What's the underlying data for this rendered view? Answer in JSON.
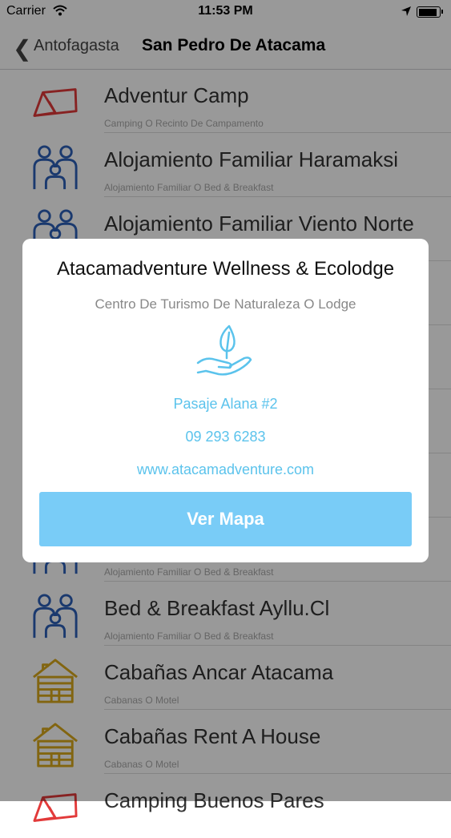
{
  "status_bar": {
    "carrier": "Carrier",
    "time": "11:53 PM",
    "battery_level": 0.9
  },
  "nav": {
    "back_label": "Antofagasta",
    "title": "San Pedro De Atacama"
  },
  "list": [
    {
      "title": "Adventur Camp",
      "subtitle": "Camping O Recinto De Campamento",
      "icon": "tent-icon"
    },
    {
      "title": "Alojamiento Familiar Haramaksi",
      "subtitle": "Alojamiento Familiar O Bed & Breakfast",
      "icon": "family-icon"
    },
    {
      "title": "Alojamiento Familiar Viento Norte",
      "subtitle": "",
      "icon": "family-icon"
    },
    {
      "title": "",
      "subtitle": "",
      "icon": ""
    },
    {
      "title": "",
      "subtitle": "",
      "icon": ""
    },
    {
      "title": "",
      "subtitle": "",
      "icon": ""
    },
    {
      "title": "",
      "subtitle": "",
      "icon": ""
    },
    {
      "title": "",
      "subtitle": "Alojamiento Familiar O Bed & Breakfast",
      "icon": "family-icon"
    },
    {
      "title": "Bed & Breakfast Ayllu.Cl",
      "subtitle": "Alojamiento Familiar O Bed & Breakfast",
      "icon": "family-icon"
    },
    {
      "title": "Cabañas Ancar Atacama",
      "subtitle": "Cabanas O Motel",
      "icon": "cabin-icon"
    },
    {
      "title": "Cabañas Rent A House",
      "subtitle": "Cabanas O Motel",
      "icon": "cabin-icon"
    },
    {
      "title": "Camping Buenos Pares",
      "subtitle": "",
      "icon": "tent-icon"
    }
  ],
  "modal": {
    "title": "Atacamadventure Wellness & Ecolodge",
    "subtitle": "Centro De Turismo De Naturaleza O Lodge",
    "icon": "leaf-hand-icon",
    "address": "Pasaje Alana #2",
    "phone": "09 293 6283",
    "website": "www.atacamadventure.com",
    "button_label": "Ver Mapa"
  },
  "colors": {
    "tent": "#e23a3a",
    "family": "#2c5fb8",
    "cabin": "#d9a91c",
    "accent": "#5bc3ec",
    "button": "#79ccf7"
  }
}
